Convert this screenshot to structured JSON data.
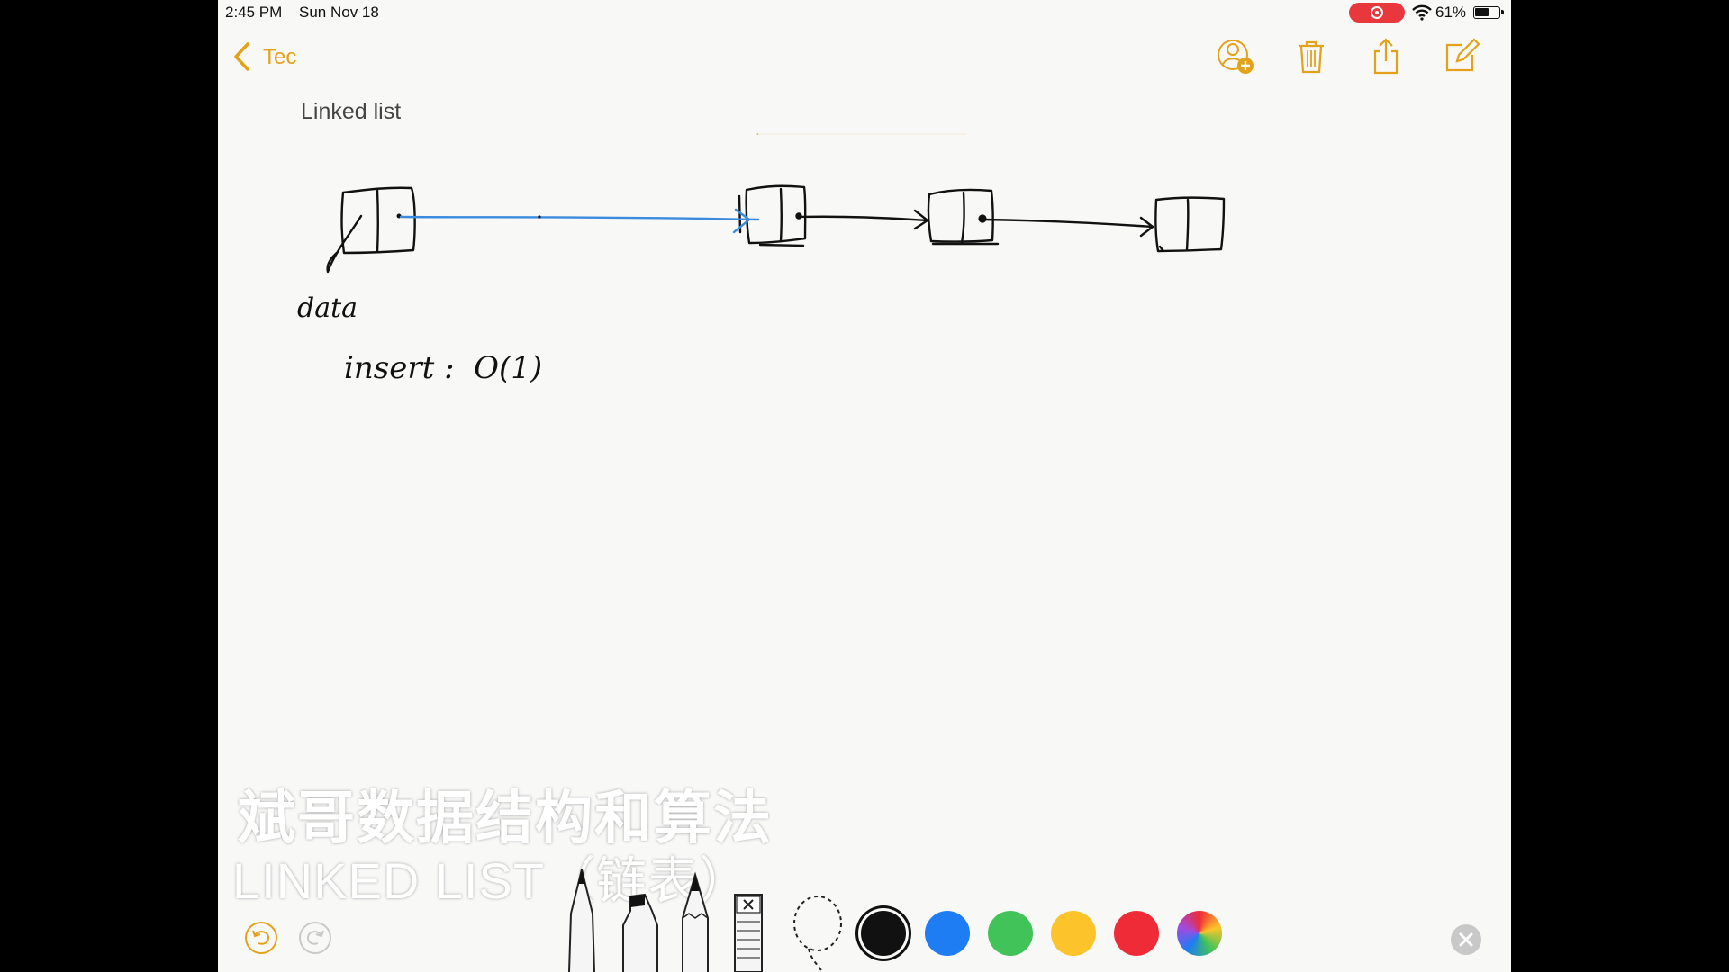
{
  "status_bar": {
    "time": "2:45 PM",
    "date": "Sun Nov 18",
    "battery": "61%",
    "battery_level": 0.61
  },
  "nav": {
    "back_label": "Tec"
  },
  "note": {
    "title": "Linked list",
    "handwriting": {
      "label_data": "data",
      "insert_line": "insert :  O(1)"
    }
  },
  "subtitle": {
    "line1": "斌哥数据结构和算法",
    "line2": "LINKED LIST（链表）"
  },
  "icons": {
    "back": "chevron-left-icon",
    "collaborate": "add-person-icon",
    "trash": "trash-icon",
    "share": "share-icon",
    "compose": "compose-icon",
    "undo": "undo-icon",
    "redo": "redo-icon",
    "close": "close-icon"
  },
  "toolbar": {
    "tools": [
      "pen",
      "marker",
      "pencil",
      "eraser",
      "lasso"
    ],
    "colors": [
      "#111111",
      "#1e7df2",
      "#41c35a",
      "#fcc42a",
      "#ee2b37",
      "multicolor"
    ],
    "selected_color": "#111111"
  },
  "theme": {
    "accent": "#e3a21a",
    "ink_blue": "#3a8be0",
    "rule": "#e6b660"
  }
}
